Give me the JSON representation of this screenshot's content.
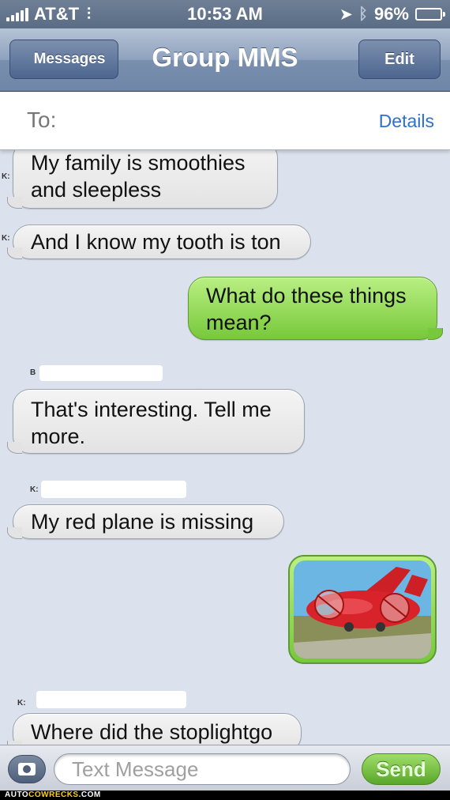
{
  "status_bar": {
    "carrier": "AT&T",
    "time": "10:53 AM",
    "battery": "96%",
    "battery_level": 0.96
  },
  "nav": {
    "back_label": "Messages",
    "title": "Group MMS",
    "edit_label": "Edit"
  },
  "recipients": {
    "to_label": "To:",
    "details_label": "Details"
  },
  "messages": [
    {
      "direction": "in",
      "sender": "K:",
      "text_lines": [
        "My family is smoothies",
        "and sleepless"
      ]
    },
    {
      "direction": "in",
      "sender": "K:",
      "text": "And I know my tooth is ton"
    },
    {
      "direction": "out",
      "text_lines": [
        "What do these things",
        "mean?"
      ]
    },
    {
      "direction": "in",
      "sender": "B",
      "text_lines": [
        "That's interesting. Tell me",
        "more."
      ]
    },
    {
      "direction": "in",
      "sender": "K:",
      "text": "My red plane is missing"
    },
    {
      "direction": "out",
      "type": "image",
      "image": "red-cartoon-plane"
    },
    {
      "direction": "in",
      "sender": "K:",
      "text": "Where did the stoplightgo"
    }
  ],
  "composer": {
    "placeholder": "Text Message",
    "send_label": "Send",
    "camera_icon": "camera-icon"
  },
  "watermark": {
    "prefix": "AUTO",
    "accent": "COWRECKS",
    "suffix": ".COM"
  },
  "colors": {
    "incoming_bubble": "#e8e8e8",
    "outgoing_bubble": "#8fd655",
    "background": "#dbe2ed",
    "link": "#2e6fd1"
  }
}
